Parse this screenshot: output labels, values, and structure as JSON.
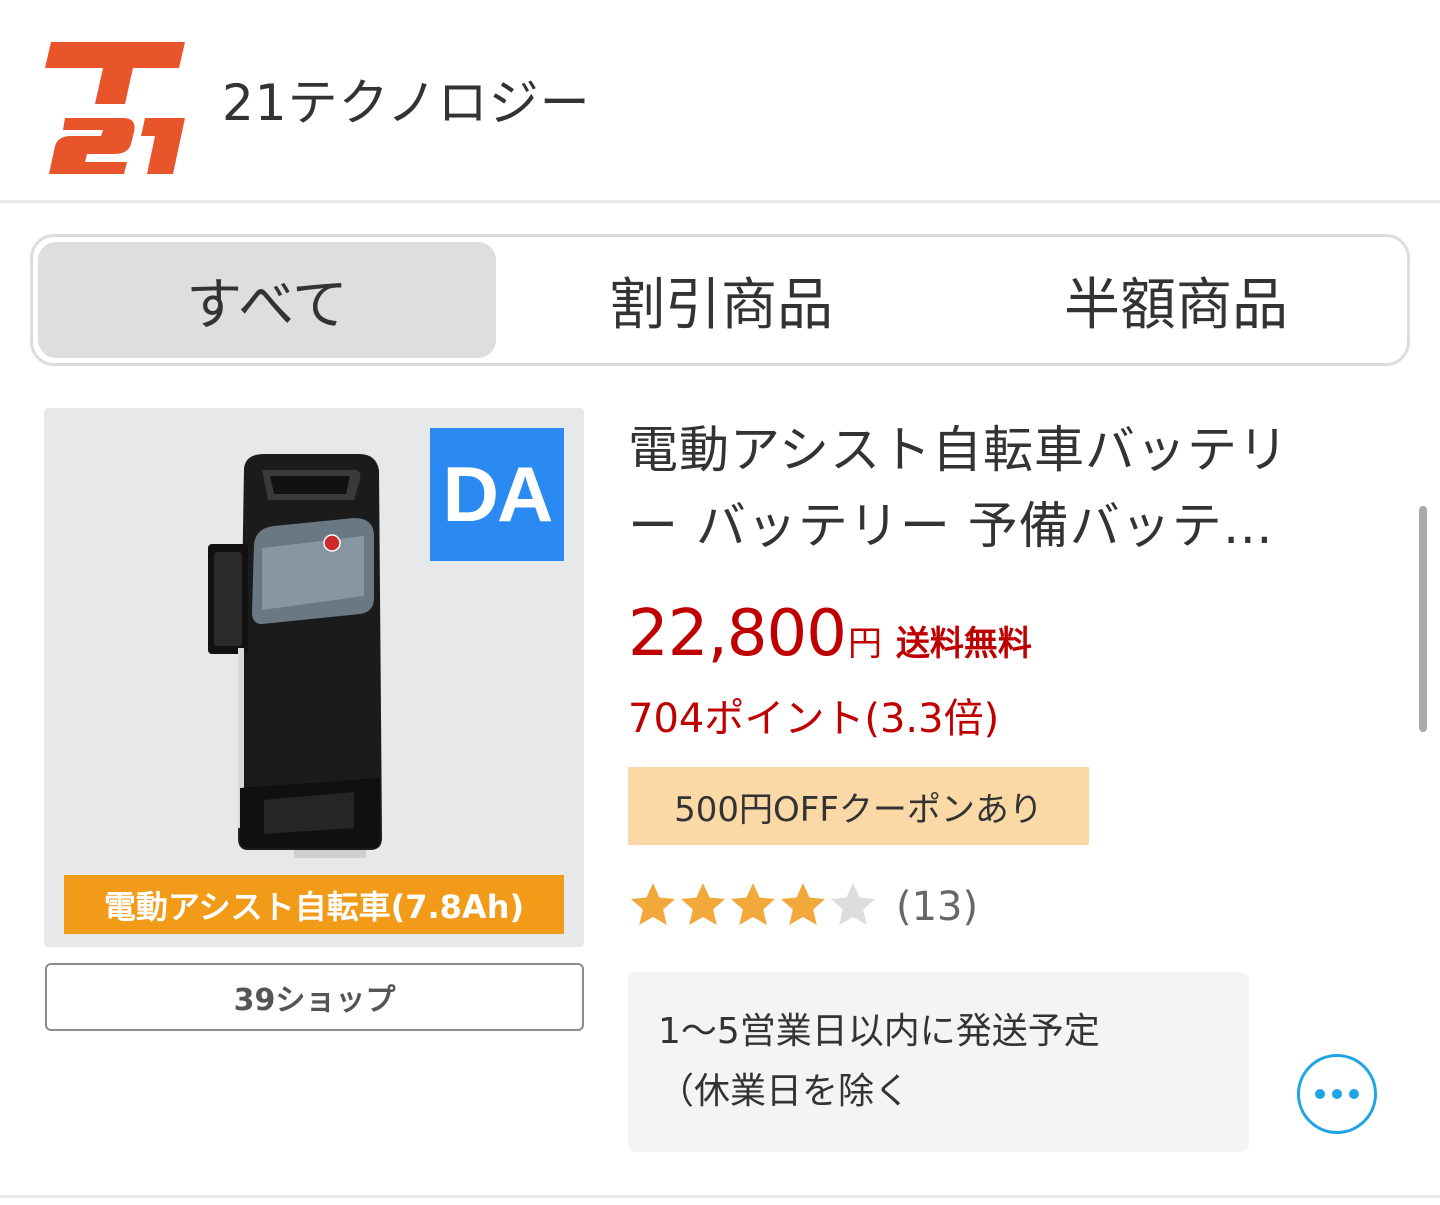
{
  "header": {
    "shop_name": "21テクノロジー",
    "logo_text": "T21"
  },
  "tabs": [
    {
      "label": "すべて",
      "active": true
    },
    {
      "label": "割引商品",
      "active": false
    },
    {
      "label": "半額商品",
      "active": false
    }
  ],
  "product": {
    "badge": "DA",
    "image_caption": "電動アシスト自転車(7.8Ah)",
    "shop_button": "39ショップ",
    "title_line1": "電動アシスト自転車バッテリ",
    "title_line2": "ー バッテリー 予備バッテ…",
    "price": "22,800",
    "price_unit": "円",
    "shipping": "送料無料",
    "points": "704ポイント(3.3倍)",
    "coupon": "500円OFFクーポンあり",
    "rating": {
      "stars": 4,
      "max_stars": 5,
      "review_count": "(13)"
    },
    "delivery_line1": "1〜5営業日以内に発送予定",
    "delivery_line2": "（休業日を除く"
  },
  "colors": {
    "brand_orange": "#e8552a",
    "price_red": "#bf0000",
    "caption_orange": "#f29b18",
    "badge_blue": "#2b8af2",
    "coupon_bg": "#fbd9a7",
    "star_filled": "#f2a93b",
    "star_empty": "#dddddd",
    "more_blue": "#1fa4e6"
  },
  "icons": {
    "more": "more-dots-icon",
    "star": "star-icon"
  }
}
